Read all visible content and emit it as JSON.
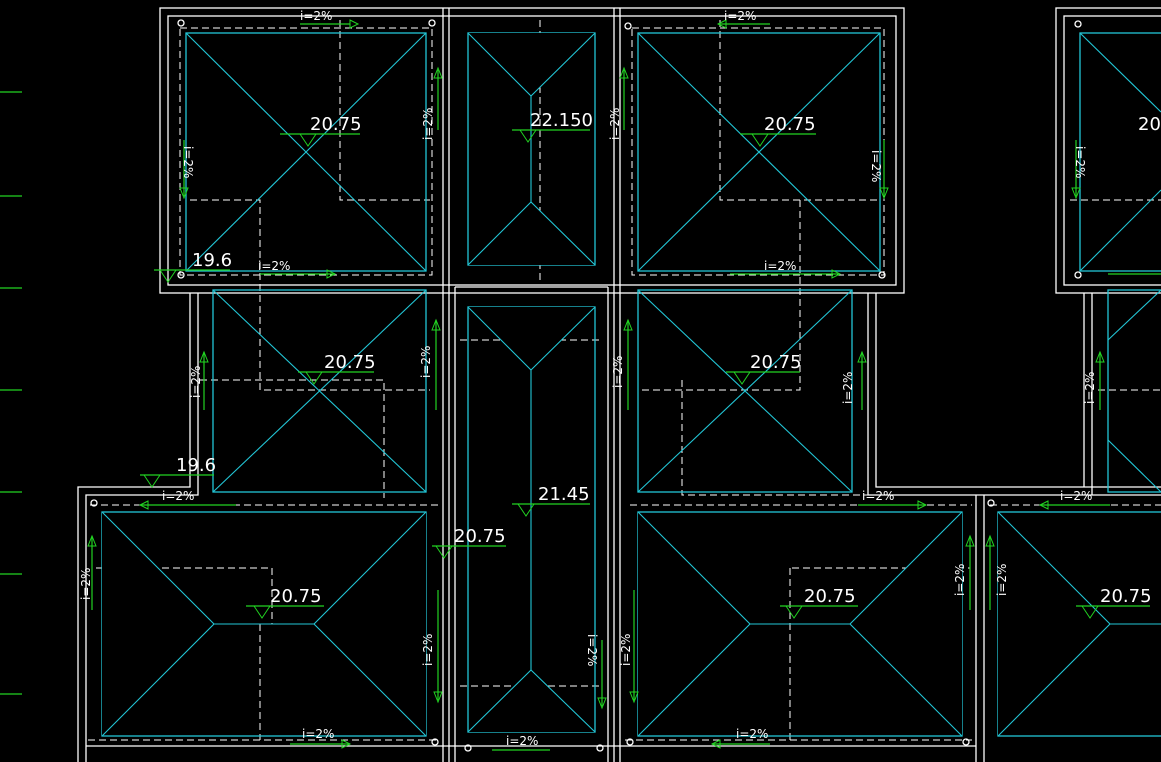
{
  "colors": {
    "background": "#000000",
    "wall": "#ffffff",
    "roof_outline": "#22c6d6",
    "slope_arrow": "#22d322",
    "text": "#ffffff"
  },
  "elevations": {
    "top_left": "20.75",
    "top_mid": "22.150",
    "top_right": "20.75",
    "top_far_right": "20",
    "mid_left": "20.75",
    "mid_center": "21.45",
    "mid_right": "20.75",
    "corner_upper": "19.6",
    "corner_lower": "19.6",
    "stair_center": "20.75",
    "bot_left": "20.75",
    "bot_right": "20.75",
    "bot_far_right": "20.75"
  },
  "slope_label": "i=2%"
}
